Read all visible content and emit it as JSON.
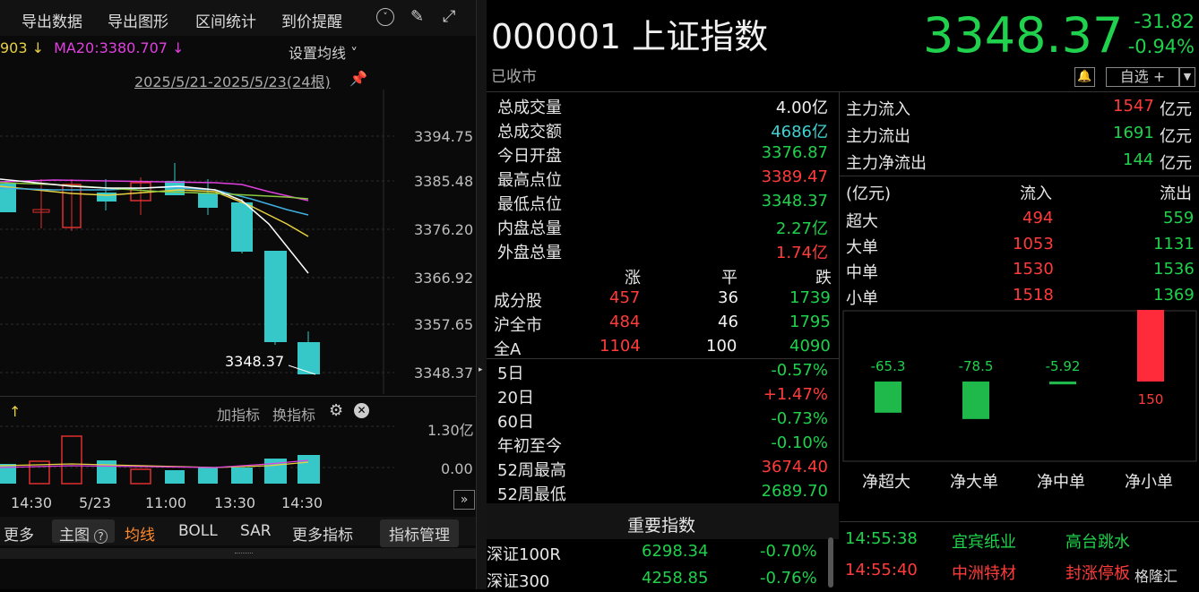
{
  "toolbar": {
    "export_data": "导出数据",
    "export_chart": "导出图形",
    "range_stats": "区间统计",
    "price_alert": "到价提醒"
  },
  "ma": {
    "ma10_partial": "903 ↓",
    "ma20": "MA20:3380.707 ↓",
    "set_ma": "设置均线 ˅"
  },
  "chart": {
    "date_range": "2025/5/21-2025/5/23(24根)",
    "yticks": [
      "3394.75",
      "3385.48",
      "3376.20",
      "3366.92",
      "3357.65",
      "3348.37"
    ],
    "last_label": "3348.37",
    "vol_ticks": [
      "1.30亿",
      "0.00"
    ],
    "sub_arrow": "↑",
    "add_indicator": "加指标",
    "switch_indicator": "换指标",
    "xticks": [
      "14:30",
      "5/23",
      "11:00",
      "13:30",
      "14:30"
    ],
    "expand": "»"
  },
  "bottom_tabs": {
    "more": "更多",
    "main": "主图",
    "ma": "均线",
    "boll": "BOLL",
    "sar": "SAR",
    "more_ind": "更多指标",
    "manage": "指标管理"
  },
  "quote": {
    "code": "000001 上证指数",
    "status": "已收市",
    "price": "3348.37",
    "change": "-31.82",
    "pct": "-0.94%",
    "watch": "自选 +"
  },
  "stats": [
    {
      "label": "总成交量",
      "value": "4.00亿",
      "color": "white"
    },
    {
      "label": "总成交额",
      "value": "4686亿",
      "color": "teal"
    },
    {
      "label": "今日开盘",
      "value": "3376.87",
      "color": "green"
    },
    {
      "label": "最高点位",
      "value": "3389.47",
      "color": "red"
    },
    {
      "label": "最低点位",
      "value": "3348.37",
      "color": "green"
    },
    {
      "label": "内盘总量",
      "value": "2.27亿",
      "color": "green"
    },
    {
      "label": "外盘总量",
      "value": "1.74亿",
      "color": "red"
    }
  ],
  "breadth": {
    "headers": [
      "涨",
      "平",
      "跌"
    ],
    "rows": [
      {
        "label": "成分股",
        "up": "457",
        "flat": "36",
        "down": "1739"
      },
      {
        "label": "沪全市",
        "up": "484",
        "flat": "46",
        "down": "1795"
      },
      {
        "label": "全A",
        "up": "1104",
        "flat": "100",
        "down": "4090"
      }
    ]
  },
  "perf": [
    {
      "label": "5日",
      "value": "-0.57%",
      "color": "green"
    },
    {
      "label": "20日",
      "value": "+1.47%",
      "color": "red"
    },
    {
      "label": "60日",
      "value": "-0.73%",
      "color": "green"
    },
    {
      "label": "年初至今",
      "value": "-0.10%",
      "color": "green"
    },
    {
      "label": "52周最高",
      "value": "3674.40",
      "color": "red"
    },
    {
      "label": "52周最低",
      "value": "2689.70",
      "color": "green"
    }
  ],
  "flows": {
    "main_in_label": "主力流入",
    "main_in": "1547",
    "main_in_unit": "亿元",
    "main_out_label": "主力流出",
    "main_out": "1691",
    "main_out_unit": "亿元",
    "net_label": "主力净流出",
    "net": "144",
    "net_unit": "亿元",
    "table_head": [
      "(亿元)",
      "流入",
      "流出"
    ],
    "rows": [
      {
        "label": "超大",
        "in": "494",
        "out": "559"
      },
      {
        "label": "大单",
        "in": "1053",
        "out": "1131"
      },
      {
        "label": "中单",
        "in": "1530",
        "out": "1536"
      },
      {
        "label": "小单",
        "in": "1518",
        "out": "1369"
      }
    ]
  },
  "chart_data": {
    "type": "bar",
    "categories": [
      "净超大",
      "净大单",
      "净中单",
      "净小单"
    ],
    "values": [
      -65.3,
      -78.5,
      -5.92,
      150
    ],
    "labels": [
      "-65.3",
      "-78.5",
      "-5.92",
      "150"
    ]
  },
  "indices": {
    "head": "重要指数",
    "rows": [
      {
        "name": "深证100R",
        "price": "6298.34",
        "pct": "-0.70%"
      },
      {
        "name": "深证300",
        "price": "4258.85",
        "pct": "-0.76%"
      }
    ]
  },
  "ticks": [
    {
      "time": "14:55:38",
      "name": "宜宾纸业",
      "event": "高台跳水",
      "color": "green"
    },
    {
      "time": "14:55:40",
      "name": "中洲特材",
      "event": "封涨停板",
      "color": "red"
    }
  ],
  "watermark": "格隆汇"
}
